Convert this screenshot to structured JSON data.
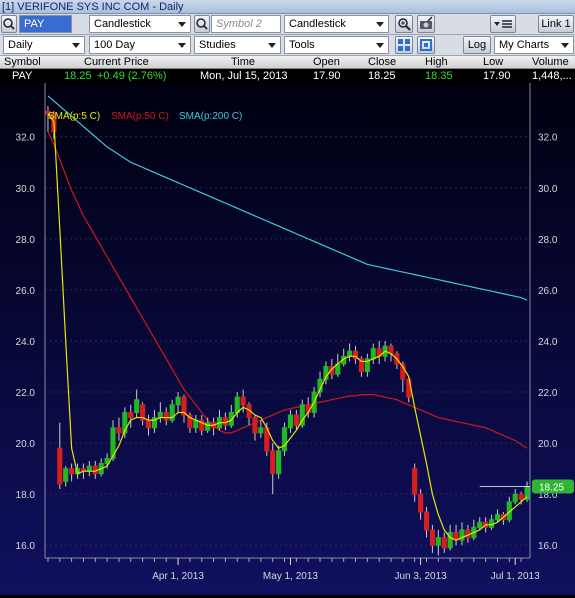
{
  "window": {
    "title": "[1] VERIFONE SYS INC COM - Daily"
  },
  "toolbar1": {
    "symbol_value": "PAY",
    "chart_type_1": "Candlestick",
    "symbol2_placeholder": "Symbol 2",
    "chart_type_2": "Candlestick",
    "link_label": "Link 1"
  },
  "toolbar2": {
    "period": "Daily",
    "range": "100 Day",
    "studies": "Studies",
    "tools": "Tools",
    "log_label": "Log",
    "my_charts": "My Charts"
  },
  "quote_header": [
    "Symbol",
    "Current Price",
    "Time",
    "Open",
    "Close",
    "High",
    "Low",
    "Volume"
  ],
  "quote_row": {
    "symbol": "PAY",
    "current_price": "18.25",
    "change": "+0.49 (2.76%)",
    "time": "Mon, Jul 15, 2013",
    "open": "17.90",
    "close": "18.25",
    "high": "18.35",
    "low": "17.90",
    "volume": "1,448,..."
  },
  "colors": {
    "background": "#0a0a3c",
    "up": "#22b822",
    "down": "#d81e1e",
    "sma5": "#e6e600",
    "sma50": "#d01818",
    "sma200": "#3ec8d8",
    "positive": "#39d639",
    "price_badge": "#2fb52f"
  },
  "chart_data": {
    "type": "candlestick",
    "ylim": [
      15.5,
      33.4
    ],
    "y_ticks": [
      "16.0",
      "18.0",
      "20.0",
      "22.0",
      "24.0",
      "26.0",
      "28.0",
      "30.0",
      "32.0"
    ],
    "x_labels": [
      "Apr 1, 2013",
      "May 1, 2013",
      "Jun 3, 2013",
      "Jul 1, 2013"
    ],
    "last_price_label": "18.25",
    "legend": [
      {
        "name": "SMA(p:5 C)"
      },
      {
        "name": "SMA(p:50 C)"
      },
      {
        "name": "SMA(p:200 C)"
      }
    ],
    "candles": [
      [
        33.0,
        32.9,
        33.2,
        32.2
      ],
      [
        32.9,
        32.2,
        33.0,
        31.9
      ],
      [
        19.8,
        18.4,
        20.8,
        18.2
      ],
      [
        18.5,
        19.0,
        19.1,
        18.3
      ],
      [
        19.0,
        18.8,
        19.2,
        18.5
      ],
      [
        18.8,
        19.0,
        19.2,
        18.6
      ],
      [
        19.0,
        18.9,
        19.2,
        18.6
      ],
      [
        18.9,
        19.1,
        19.3,
        18.7
      ],
      [
        19.1,
        18.8,
        19.3,
        18.6
      ],
      [
        18.8,
        19.2,
        19.4,
        18.7
      ],
      [
        19.2,
        19.4,
        19.6,
        19.0
      ],
      [
        19.4,
        20.6,
        20.9,
        19.3
      ],
      [
        20.6,
        20.4,
        21.0,
        20.1
      ],
      [
        20.4,
        21.2,
        21.4,
        20.2
      ],
      [
        21.2,
        21.0,
        21.5,
        20.6
      ],
      [
        21.2,
        21.7,
        22.1,
        21.0
      ],
      [
        21.5,
        20.9,
        21.6,
        20.7
      ],
      [
        20.9,
        20.6,
        21.1,
        20.3
      ],
      [
        20.6,
        21.0,
        21.3,
        20.4
      ],
      [
        21.0,
        21.2,
        21.6,
        20.8
      ],
      [
        21.2,
        20.9,
        21.4,
        20.7
      ],
      [
        20.9,
        21.5,
        21.7,
        20.8
      ],
      [
        21.5,
        21.8,
        22.0,
        21.2
      ],
      [
        21.8,
        21.1,
        21.9,
        20.8
      ],
      [
        21.1,
        20.6,
        21.2,
        20.4
      ],
      [
        20.6,
        20.9,
        21.1,
        20.4
      ],
      [
        20.9,
        20.5,
        21.1,
        20.3
      ],
      [
        20.5,
        20.8,
        21.0,
        20.4
      ],
      [
        20.8,
        20.6,
        21.0,
        20.3
      ],
      [
        20.6,
        21.0,
        21.3,
        20.5
      ],
      [
        21.0,
        20.7,
        21.2,
        20.5
      ],
      [
        20.7,
        21.2,
        21.5,
        20.6
      ],
      [
        21.2,
        21.8,
        22.0,
        21.0
      ],
      [
        21.8,
        21.5,
        22.1,
        21.2
      ],
      [
        21.5,
        21.0,
        21.6,
        20.7
      ],
      [
        21.0,
        20.4,
        21.1,
        20.1
      ],
      [
        20.4,
        20.6,
        20.9,
        20.2
      ],
      [
        20.6,
        19.7,
        20.8,
        19.5
      ],
      [
        19.7,
        18.8,
        20.0,
        18.0
      ],
      [
        18.8,
        19.7,
        19.9,
        18.6
      ],
      [
        19.7,
        20.6,
        20.8,
        19.5
      ],
      [
        20.6,
        21.1,
        21.3,
        20.4
      ],
      [
        21.1,
        20.7,
        21.3,
        20.5
      ],
      [
        20.7,
        21.5,
        21.7,
        20.6
      ],
      [
        21.5,
        21.2,
        21.8,
        21.0
      ],
      [
        21.2,
        22.0,
        22.2,
        21.0
      ],
      [
        22.0,
        22.5,
        22.8,
        21.8
      ],
      [
        22.5,
        23.0,
        23.2,
        22.3
      ],
      [
        23.0,
        22.7,
        23.3,
        22.5
      ],
      [
        22.7,
        23.1,
        23.5,
        22.6
      ],
      [
        23.1,
        23.4,
        23.7,
        23.0
      ],
      [
        23.4,
        23.6,
        23.9,
        23.2
      ],
      [
        23.6,
        23.3,
        23.8,
        23.1
      ],
      [
        23.3,
        22.8,
        23.4,
        22.6
      ],
      [
        22.8,
        23.3,
        23.5,
        22.6
      ],
      [
        23.3,
        23.7,
        23.9,
        23.1
      ],
      [
        23.7,
        23.4,
        24.0,
        23.1
      ],
      [
        23.4,
        23.8,
        24.0,
        23.2
      ],
      [
        23.8,
        23.5,
        23.9,
        23.2
      ],
      [
        23.5,
        23.1,
        23.6,
        22.9
      ],
      [
        23.1,
        22.5,
        23.2,
        22.0
      ],
      [
        22.5,
        21.8,
        22.6,
        21.6
      ],
      [
        19.0,
        18.0,
        19.2,
        17.7
      ],
      [
        18.0,
        17.3,
        18.2,
        17.0
      ],
      [
        17.3,
        16.6,
        17.5,
        16.3
      ],
      [
        16.6,
        16.0,
        16.8,
        15.7
      ],
      [
        16.0,
        16.3,
        16.6,
        15.6
      ],
      [
        16.3,
        15.9,
        16.5,
        15.7
      ],
      [
        15.9,
        16.5,
        16.8,
        15.8
      ],
      [
        16.5,
        16.2,
        16.8,
        16.0
      ],
      [
        16.2,
        16.6,
        16.9,
        16.0
      ],
      [
        16.6,
        16.3,
        16.8,
        16.1
      ],
      [
        16.3,
        16.7,
        17.0,
        16.2
      ],
      [
        16.7,
        16.9,
        17.1,
        16.6
      ],
      [
        16.9,
        16.7,
        17.1,
        16.5
      ],
      [
        16.7,
        17.0,
        17.2,
        16.6
      ],
      [
        17.0,
        17.2,
        17.4,
        16.9
      ],
      [
        17.2,
        17.0,
        17.3,
        16.8
      ],
      [
        17.0,
        17.7,
        17.9,
        16.9
      ],
      [
        17.7,
        18.0,
        18.2,
        17.6
      ],
      [
        18.0,
        17.8,
        18.1,
        17.6
      ],
      [
        17.8,
        18.3,
        18.5,
        17.7
      ]
    ],
    "sma5": [
      32.9,
      32.6,
      28.4,
      24.0,
      19.8,
      18.8,
      18.9,
      18.9,
      18.9,
      19.0,
      19.1,
      19.5,
      19.9,
      20.5,
      20.9,
      21.0,
      21.0,
      20.9,
      20.9,
      21.0,
      21.0,
      21.0,
      21.2,
      21.2,
      21.0,
      20.9,
      20.8,
      20.7,
      20.7,
      20.8,
      20.8,
      20.9,
      21.2,
      21.4,
      21.3,
      21.1,
      21.0,
      20.6,
      20.1,
      19.8,
      19.9,
      20.2,
      20.5,
      20.9,
      21.2,
      21.6,
      22.1,
      22.6,
      22.9,
      23.1,
      23.3,
      23.4,
      23.4,
      23.2,
      23.2,
      23.3,
      23.4,
      23.6,
      23.5,
      23.3,
      23.0,
      22.6,
      21.4,
      20.3,
      19.2,
      18.0,
      17.2,
      16.6,
      16.3,
      16.2,
      16.3,
      16.4,
      16.5,
      16.6,
      16.8,
      16.8,
      16.9,
      17.1,
      17.3,
      17.5,
      17.7,
      17.9
    ],
    "sma50": [
      32.2,
      31.7,
      31.1,
      30.5,
      29.9,
      29.4,
      28.9,
      28.5,
      28.1,
      27.7,
      27.3,
      26.9,
      26.5,
      26.1,
      25.7,
      25.3,
      24.9,
      24.5,
      24.1,
      23.7,
      23.3,
      22.9,
      22.5,
      22.1,
      21.8,
      21.5,
      21.2,
      20.9,
      20.7,
      20.5,
      20.4,
      20.4,
      20.5,
      20.6,
      20.7,
      20.8,
      20.9,
      21.0,
      21.1,
      21.2,
      21.3,
      21.35,
      21.4,
      21.45,
      21.5,
      21.55,
      21.6,
      21.65,
      21.7,
      21.75,
      21.8,
      21.85,
      21.85,
      21.9,
      21.9,
      21.9,
      21.85,
      21.8,
      21.75,
      21.7,
      21.6,
      21.5,
      21.4,
      21.3,
      21.2,
      21.1,
      21.0,
      20.95,
      20.9,
      20.85,
      20.8,
      20.75,
      20.7,
      20.65,
      20.6,
      20.5,
      20.4,
      20.3,
      20.2,
      20.1,
      19.95,
      19.8
    ],
    "sma200": [
      33.6,
      33.4,
      33.2,
      33.0,
      32.8,
      32.6,
      32.4,
      32.2,
      32.0,
      31.8,
      31.6,
      31.45,
      31.3,
      31.15,
      31.0,
      30.9,
      30.8,
      30.7,
      30.6,
      30.5,
      30.4,
      30.3,
      30.2,
      30.1,
      30.0,
      29.9,
      29.8,
      29.7,
      29.6,
      29.5,
      29.4,
      29.3,
      29.2,
      29.1,
      29.0,
      28.9,
      28.8,
      28.7,
      28.6,
      28.5,
      28.4,
      28.3,
      28.2,
      28.1,
      28.0,
      27.9,
      27.8,
      27.7,
      27.6,
      27.5,
      27.4,
      27.3,
      27.2,
      27.1,
      27.0,
      26.95,
      26.9,
      26.85,
      26.8,
      26.75,
      26.7,
      26.65,
      26.6,
      26.55,
      26.5,
      26.45,
      26.4,
      26.35,
      26.3,
      26.25,
      26.2,
      26.15,
      26.1,
      26.05,
      26.0,
      25.95,
      25.9,
      25.85,
      25.8,
      25.75,
      25.7,
      25.6
    ]
  }
}
